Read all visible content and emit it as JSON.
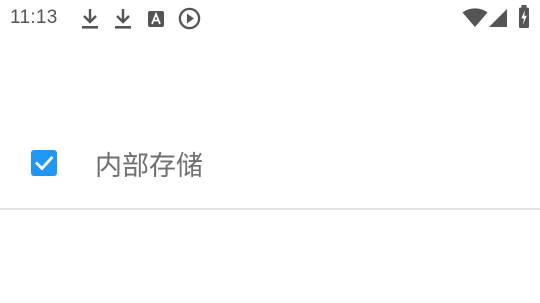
{
  "status_bar": {
    "time": "11:13",
    "notification_icons": [
      "download-icon",
      "download-icon",
      "font-a-icon",
      "play-circle-icon"
    ],
    "system_icons": [
      "wifi-icon",
      "cell-signal-icon",
      "battery-charging-icon"
    ]
  },
  "storage_option": {
    "label": "内部存储",
    "checked": true,
    "checkbox_color": "#2196f3"
  }
}
